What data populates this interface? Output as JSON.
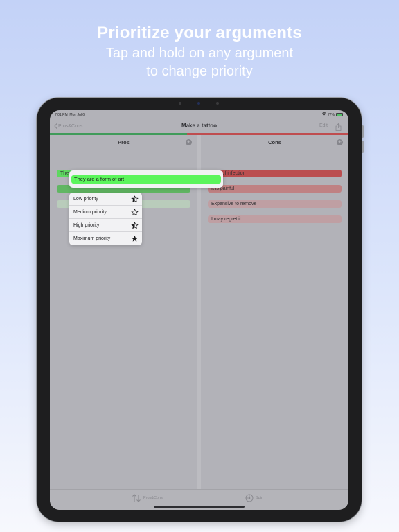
{
  "promo": {
    "headline": "Prioritize your arguments",
    "subline_1": "Tap and hold on any argument",
    "subline_2": "to change priority"
  },
  "status_bar": {
    "time": "7:01 PM",
    "date": "Mon Jul 6",
    "battery": "77%",
    "battery_level": 0.77
  },
  "nav": {
    "back_label": "Pros&Cons",
    "title": "Make a tattoo",
    "edit_label": "Edit",
    "share_icon": "share-icon"
  },
  "balance": {
    "pros_fraction": 0.46,
    "pros_color": "#34a853",
    "cons_color": "#d64545"
  },
  "pros": {
    "title": "Pros",
    "items": [
      {
        "text": "They are a form of art",
        "color": "#5cf55c"
      },
      {
        "text": "",
        "color": "#5ecb5e"
      },
      {
        "text": "",
        "color": "#cfe7cf"
      }
    ]
  },
  "cons": {
    "title": "Cons",
    "items": [
      {
        "text": "Risk of infection",
        "color": "#d14646"
      },
      {
        "text": "It is painful",
        "color": "#d78787"
      },
      {
        "text": "Expensive to remove",
        "color": "#d7aeb0"
      },
      {
        "text": "I may regret it",
        "color": "#d7aeb0"
      }
    ]
  },
  "popup": {
    "selected_argument": "They are a form of art",
    "menu": [
      {
        "label": "Low priority",
        "icon": "star-quarter-icon"
      },
      {
        "label": "Medium priority",
        "icon": "star-outline-icon"
      },
      {
        "label": "High priority",
        "icon": "star-half-icon"
      },
      {
        "label": "Maximum priority",
        "icon": "star-filled-icon"
      }
    ]
  },
  "tabs": [
    {
      "label": "Pros&Cons",
      "icon": "sort-arrows-icon"
    },
    {
      "label": "Spin",
      "icon": "spin-icon"
    }
  ]
}
